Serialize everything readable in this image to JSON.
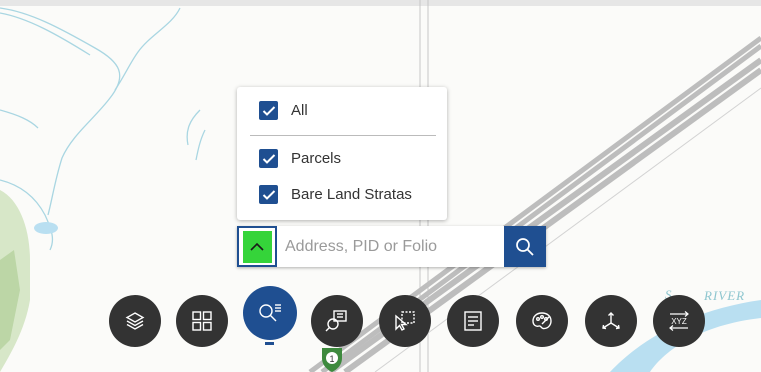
{
  "map": {
    "river_label": "RIVER",
    "river_label_partial": "S",
    "shield_number": "1",
    "colors": {
      "water": "#b9dff1",
      "park": "#d7e7c8",
      "rail": "#c8c8c8"
    }
  },
  "layer_filter": {
    "items": [
      {
        "label": "All",
        "checked": true
      },
      {
        "label": "Parcels",
        "checked": true
      },
      {
        "label": "Bare Land Stratas",
        "checked": true
      }
    ]
  },
  "search": {
    "placeholder": "Address, PID or Folio",
    "value": "",
    "toggle_icon": "chevron-up-icon",
    "button_icon": "search-icon"
  },
  "toolbar": {
    "tools": [
      {
        "name": "layers",
        "icon": "layers-icon"
      },
      {
        "name": "basemap-gallery",
        "icon": "grid-icon"
      },
      {
        "name": "search",
        "icon": "search-list-icon",
        "active": true
      },
      {
        "name": "query",
        "icon": "query-icon"
      },
      {
        "name": "select",
        "icon": "select-icon"
      },
      {
        "name": "attribute-table",
        "icon": "table-icon"
      },
      {
        "name": "styles",
        "icon": "palette-icon"
      },
      {
        "name": "coordinate-tools",
        "icon": "axes-icon"
      },
      {
        "name": "coordinate-conversion",
        "icon": "xyz-icon",
        "text": "XYZ"
      }
    ],
    "accent": "#1f4f91",
    "button_color": "#333333"
  }
}
